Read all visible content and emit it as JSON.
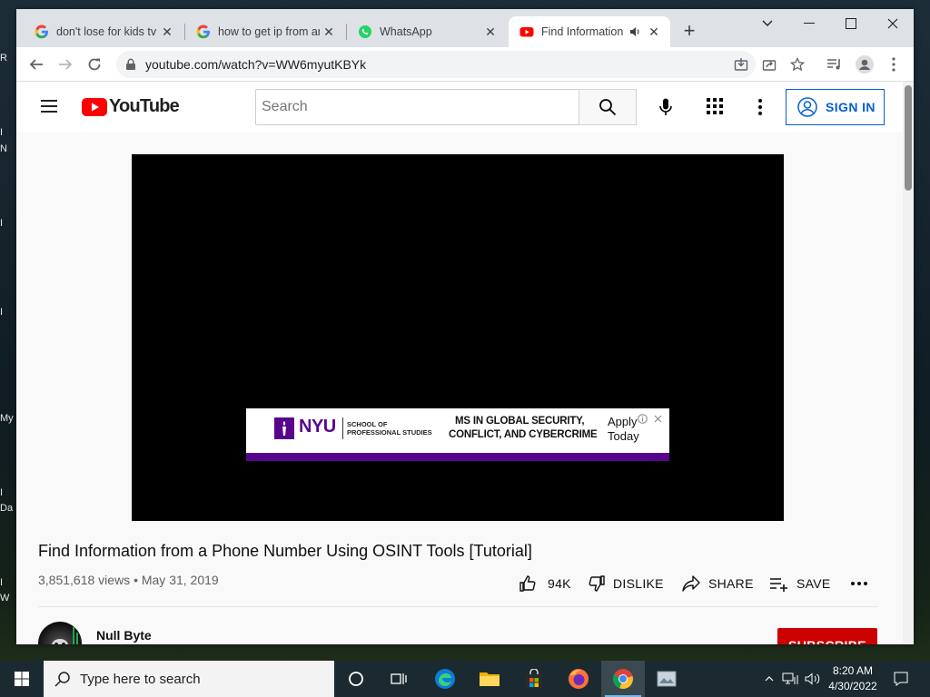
{
  "desktop": {
    "labels": [
      "R",
      "I",
      "N",
      "I",
      "I",
      "My",
      "I",
      "Da",
      "I",
      "W"
    ]
  },
  "browser": {
    "tabs": [
      {
        "title": "don't lose for kids tv",
        "favicon": "google-icon",
        "active": false
      },
      {
        "title": "how to get ip from an",
        "favicon": "google-icon",
        "active": false
      },
      {
        "title": "WhatsApp",
        "favicon": "whatsapp-icon",
        "active": false
      },
      {
        "title": "Find Information",
        "favicon": "youtube-icon",
        "active": true,
        "audio": true
      }
    ],
    "url": "youtube.com/watch?v=WW6myutKBYk"
  },
  "youtube": {
    "logo_text": "YouTube",
    "search_placeholder": "Search",
    "sign_in": "SIGN IN",
    "ad": {
      "brand": "NYU",
      "school_line1": "SCHOOL OF",
      "school_line2": "PROFESSIONAL STUDIES",
      "headline_line1": "MS IN GLOBAL SECURITY,",
      "headline_line2": "CONFLICT, AND CYBERCRIME",
      "cta_line1": "Apply",
      "cta_line2": "Today"
    },
    "video": {
      "title": "Find Information from a Phone Number Using OSINT Tools [Tutorial]",
      "meta": "3,851,618 views • May 31, 2019",
      "likes": "94K",
      "dislike": "DISLIKE",
      "share": "SHARE",
      "save": "SAVE",
      "channel": "Null Byte",
      "subscribe": "SUBSCRIBE"
    }
  },
  "taskbar": {
    "search_placeholder": "Type here to search",
    "time": "8:20 AM",
    "date": "4/30/2022"
  },
  "colors": {
    "youtube_red": "#ff0000",
    "nyu_purple": "#57068c",
    "sign_in_blue": "#065fd4",
    "subscribe_red": "#cc0000"
  }
}
